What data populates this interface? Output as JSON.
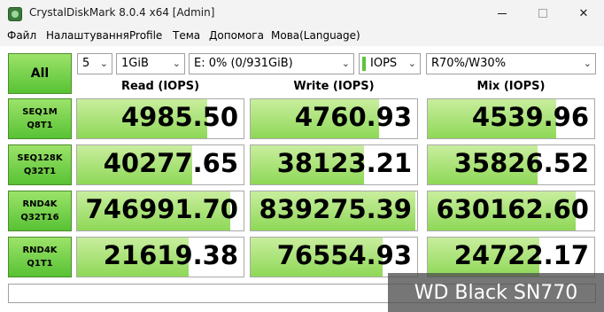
{
  "window": {
    "title": "CrystalDiskMark 8.0.4 x64 [Admin]",
    "minimize_glyph": "",
    "close_glyph": "✕"
  },
  "menu": {
    "items": [
      "Файл",
      "Налаштування",
      "Profile",
      "Тема",
      "Допомога",
      "Мова(Language)"
    ]
  },
  "toolbar": {
    "all_label": "All",
    "count": "5",
    "size": "1GiB",
    "drive": "E: 0% (0/931GiB)",
    "unit": "IOPS",
    "mix": "R70%/W30%",
    "arrow": "⌄"
  },
  "columns": [
    "Read (IOPS)",
    "Write (IOPS)",
    "Mix (IOPS)"
  ],
  "rows": [
    {
      "line1": "SEQ1M",
      "line2": "Q8T1",
      "read": "4985.50",
      "write": "4760.93",
      "mix": "4539.96"
    },
    {
      "line1": "SEQ128K",
      "line2": "Q32T1",
      "read": "40277.65",
      "write": "38123.21",
      "mix": "35826.52"
    },
    {
      "line1": "RND4K",
      "line2": "Q32T16",
      "read": "746991.70",
      "write": "839275.39",
      "mix": "630162.60"
    },
    {
      "line1": "RND4K",
      "line2": "Q1T1",
      "read": "21619.38",
      "write": "76554.93",
      "mix": "24722.17"
    }
  ],
  "fill_levels": [
    {
      "read": 0.78,
      "write": 0.77,
      "mix": 0.77
    },
    {
      "read": 0.69,
      "write": 0.68,
      "mix": 0.66
    },
    {
      "read": 0.92,
      "write": 0.99,
      "mix": 0.89
    },
    {
      "read": 0.67,
      "write": 0.79,
      "mix": 0.67
    }
  ],
  "comment": "",
  "watermark": "WD Black SN770",
  "colors": {
    "accent_green": "#58c234",
    "bar_green": "#8ed857",
    "border": "#a9a9a9"
  }
}
